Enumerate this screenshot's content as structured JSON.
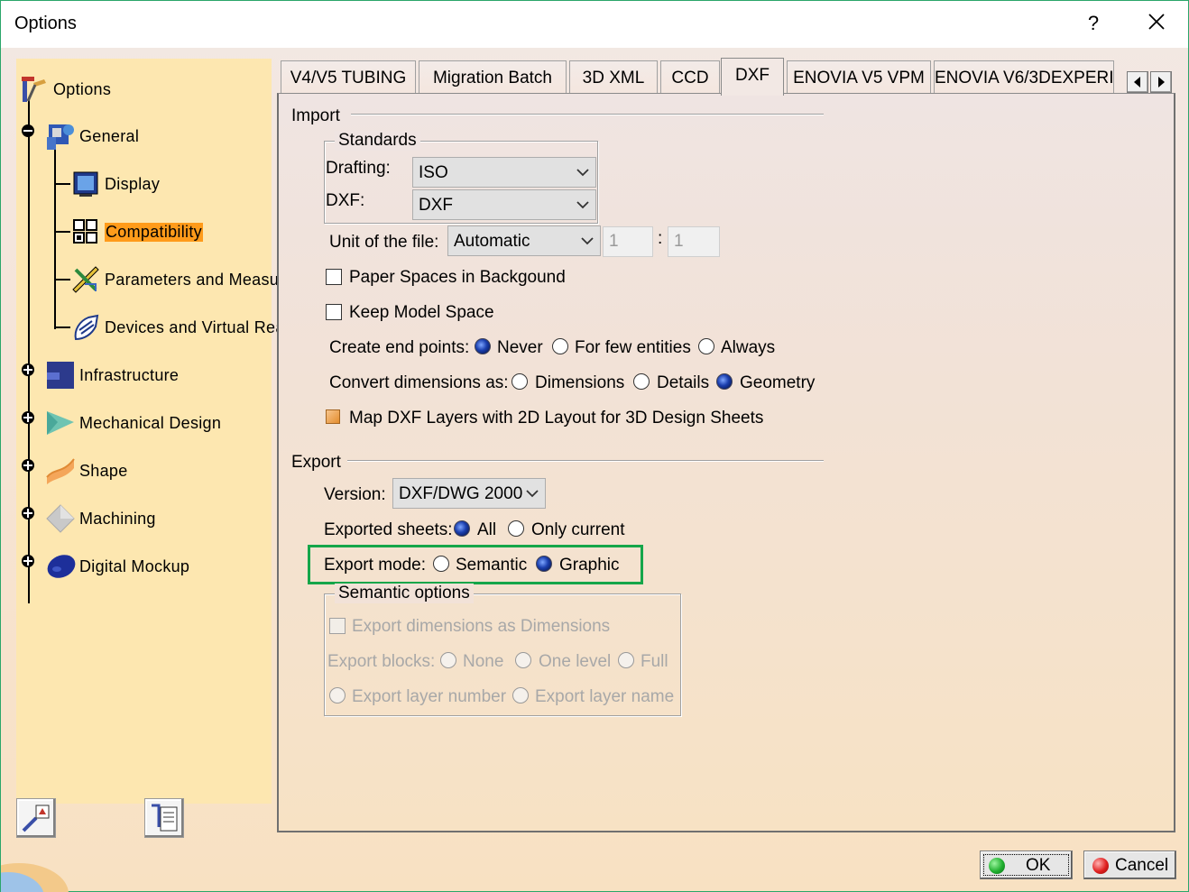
{
  "window": {
    "title": "Options",
    "help_label": "?"
  },
  "tree": {
    "root": "Options",
    "items": [
      {
        "label": "General",
        "icon": "general-icon"
      },
      {
        "label": "Display",
        "icon": "display-icon"
      },
      {
        "label": "Compatibility",
        "icon": "compatibility-icon",
        "selected": true
      },
      {
        "label": "Parameters and Measu",
        "icon": "parameters-icon"
      },
      {
        "label": "Devices and Virtual Rea",
        "icon": "devices-icon"
      },
      {
        "label": "Infrastructure",
        "icon": "infrastructure-icon"
      },
      {
        "label": "Mechanical Design",
        "icon": "mechanical-design-icon"
      },
      {
        "label": "Shape",
        "icon": "shape-icon"
      },
      {
        "label": "Machining",
        "icon": "machining-icon"
      },
      {
        "label": "Digital Mockup",
        "icon": "digital-mockup-icon"
      }
    ]
  },
  "tabs": [
    {
      "label": "V4/V5 TUBING"
    },
    {
      "label": "Migration Batch"
    },
    {
      "label": "3D XML"
    },
    {
      "label": "CCD"
    },
    {
      "label": "DXF",
      "active": true
    },
    {
      "label": "ENOVIA V5 VPM"
    },
    {
      "label": "ENOVIA V6/3DEXPERIEI"
    }
  ],
  "import": {
    "section_label": "Import",
    "standards_label": "Standards",
    "drafting_label": "Drafting:",
    "drafting_value": "ISO",
    "dxf_label": "DXF:",
    "dxf_value": "DXF",
    "unit_label": "Unit of the file:",
    "unit_value": "Automatic",
    "unit_ratio_left": "1",
    "unit_ratio_sep": ":",
    "unit_ratio_right": "1",
    "paper_spaces_label": "Paper Spaces in Backgound",
    "paper_spaces_checked": false,
    "keep_model_label": "Keep Model Space",
    "keep_model_checked": false,
    "end_points_label": "Create end points:",
    "end_points_options": [
      "Never",
      "For few entities",
      "Always"
    ],
    "end_points_selected": "Never",
    "convert_label": "Convert dimensions as:",
    "convert_options": [
      "Dimensions",
      "Details",
      "Geometry"
    ],
    "convert_selected": "Geometry",
    "map_layers_label": "Map DXF Layers with 2D Layout for 3D Design Sheets"
  },
  "export": {
    "section_label": "Export",
    "version_label": "Version:",
    "version_value": "DXF/DWG 2000",
    "sheets_label": "Exported sheets:",
    "sheets_options": [
      "All",
      "Only current"
    ],
    "sheets_selected": "All",
    "mode_label": "Export mode:",
    "mode_options": [
      "Semantic",
      "Graphic"
    ],
    "mode_selected": "Graphic",
    "highlight_color": "#15a64a",
    "semantic_options": {
      "title": "Semantic options",
      "dims_label": "Export dimensions as Dimensions",
      "blocks_label": "Export blocks:",
      "blocks_options": [
        "None",
        "One level",
        "Full"
      ],
      "layer_number_label": "Export layer number",
      "layer_name_label": "Export layer name"
    }
  },
  "buttons": {
    "ok": "OK",
    "cancel": "Cancel"
  },
  "colors": {
    "tree_bg": "#fde7b0",
    "selected_bg": "#ff9b1a",
    "ok_dot": "#1fae2e",
    "cancel_dot": "#e02020"
  }
}
